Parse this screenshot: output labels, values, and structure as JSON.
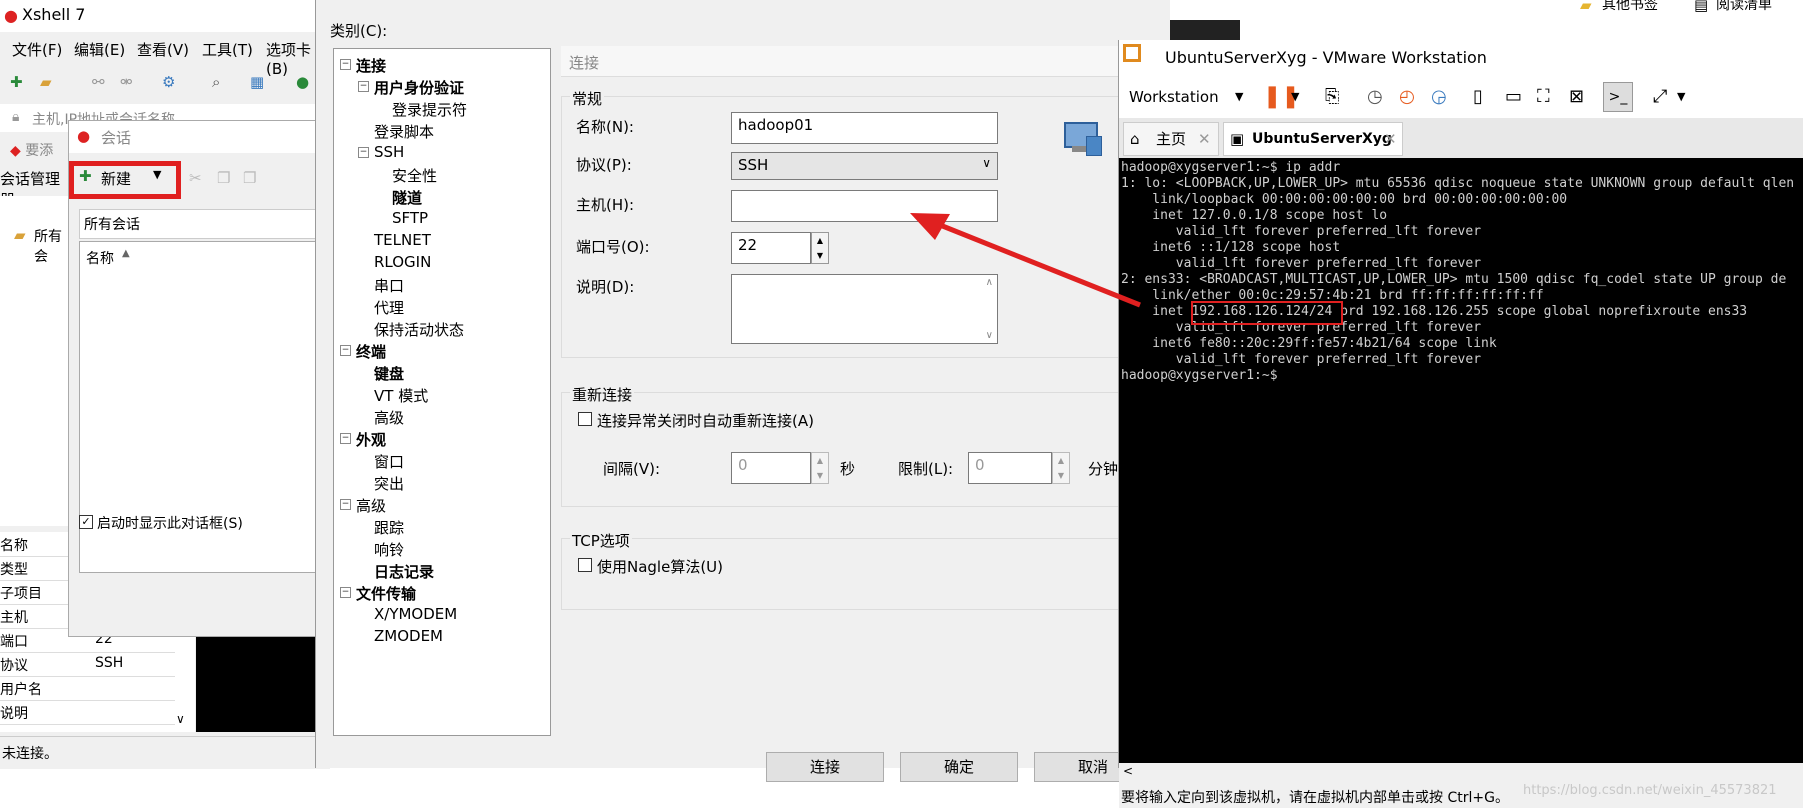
{
  "xshell": {
    "title": "Xshell 7",
    "menu": [
      "文件(F)",
      "编辑(E)",
      "查看(V)",
      "工具(T)",
      "选项卡(B)"
    ],
    "address_placeholder": "主机,IP地址或会话名称",
    "add_hint": "要添",
    "session_manager": "会话管理器",
    "tree_all": "所有会",
    "props": [
      {
        "k": "名称",
        "v": ""
      },
      {
        "k": "类型",
        "v": ""
      },
      {
        "k": "子项目",
        "v": ""
      },
      {
        "k": "主机",
        "v": ""
      },
      {
        "k": "端口",
        "v": "22"
      },
      {
        "k": "协议",
        "v": "SSH"
      },
      {
        "k": "用户名",
        "v": ""
      },
      {
        "k": "说明",
        "v": ""
      }
    ],
    "status": "未连接。"
  },
  "session_dialog": {
    "title": "会话",
    "new_label": "新建",
    "all_sessions": "所有会话",
    "col_name": "名称",
    "show_on_start": "启动时显示此对话框(S)"
  },
  "properties_dialog": {
    "category_label": "类别(C):",
    "tree": [
      {
        "label": "连接",
        "level": 0,
        "bold": true,
        "box": "−"
      },
      {
        "label": "用户身份验证",
        "level": 1,
        "bold": true,
        "box": "−"
      },
      {
        "label": "登录提示符",
        "level": 2,
        "bold": false,
        "box": ""
      },
      {
        "label": "登录脚本",
        "level": 1,
        "bold": false,
        "box": ""
      },
      {
        "label": "SSH",
        "level": 1,
        "bold": false,
        "box": "−"
      },
      {
        "label": "安全性",
        "level": 2,
        "bold": false,
        "box": ""
      },
      {
        "label": "隧道",
        "level": 2,
        "bold": true,
        "box": ""
      },
      {
        "label": "SFTP",
        "level": 2,
        "bold": false,
        "box": ""
      },
      {
        "label": "TELNET",
        "level": 1,
        "bold": false,
        "box": ""
      },
      {
        "label": "RLOGIN",
        "level": 1,
        "bold": false,
        "box": ""
      },
      {
        "label": "串口",
        "level": 1,
        "bold": false,
        "box": ""
      },
      {
        "label": "代理",
        "level": 1,
        "bold": false,
        "box": ""
      },
      {
        "label": "保持活动状态",
        "level": 1,
        "bold": false,
        "box": ""
      },
      {
        "label": "终端",
        "level": 0,
        "bold": true,
        "box": "−"
      },
      {
        "label": "键盘",
        "level": 1,
        "bold": true,
        "box": ""
      },
      {
        "label": "VT 模式",
        "level": 1,
        "bold": false,
        "box": ""
      },
      {
        "label": "高级",
        "level": 1,
        "bold": false,
        "box": ""
      },
      {
        "label": "外观",
        "level": 0,
        "bold": true,
        "box": "−"
      },
      {
        "label": "窗口",
        "level": 1,
        "bold": false,
        "box": ""
      },
      {
        "label": "突出",
        "level": 1,
        "bold": false,
        "box": ""
      },
      {
        "label": "高级",
        "level": 0,
        "bold": false,
        "box": "−"
      },
      {
        "label": "跟踪",
        "level": 1,
        "bold": false,
        "box": ""
      },
      {
        "label": "响铃",
        "level": 1,
        "bold": false,
        "box": ""
      },
      {
        "label": "日志记录",
        "level": 1,
        "bold": true,
        "box": ""
      },
      {
        "label": "文件传输",
        "level": 0,
        "bold": true,
        "box": "−"
      },
      {
        "label": "X/YMODEM",
        "level": 1,
        "bold": false,
        "box": ""
      },
      {
        "label": "ZMODEM",
        "level": 1,
        "bold": false,
        "box": ""
      }
    ],
    "section_title": "连接",
    "general": "常规",
    "name_label": "名称(N):",
    "name_value": "hadoop01",
    "protocol_label": "协议(P):",
    "protocol_value": "SSH",
    "host_label": "主机(H):",
    "host_value": "",
    "port_label": "端口号(O):",
    "port_value": "22",
    "desc_label": "说明(D):",
    "reconnect": "重新连接",
    "reconnect_check": "连接异常关闭时自动重新连接(A)",
    "interval_label": "间隔(V):",
    "interval_value": "0",
    "sec": "秒",
    "limit_label": "限制(L):",
    "limit_value": "0",
    "min": "分钟",
    "tcp": "TCP选项",
    "nagle": "使用Nagle算法(U)",
    "btn_connect": "连接",
    "btn_ok": "确定",
    "btn_cancel": "取消"
  },
  "vmware": {
    "title": "UbuntuServerXyg - VMware Workstation",
    "menu_label": "Workstation",
    "tab_home": "主页",
    "tab_vm": "UbuntuServerXyg",
    "terminal_lines": [
      "hadoop@xygserver1:~$ ip addr",
      "1: lo: <LOOPBACK,UP,LOWER_UP> mtu 65536 qdisc noqueue state UNKNOWN group default qlen",
      "    link/loopback 00:00:00:00:00:00 brd 00:00:00:00:00:00",
      "    inet 127.0.0.1/8 scope host lo",
      "       valid_lft forever preferred_lft forever",
      "    inet6 ::1/128 scope host",
      "       valid_lft forever preferred_lft forever",
      "2: ens33: <BROADCAST,MULTICAST,UP,LOWER_UP> mtu 1500 qdisc fq_codel state UP group de",
      "    link/ether 00:0c:29:57:4b:21 brd ff:ff:ff:ff:ff:ff",
      "    inet 192.168.126.124/24 brd 192.168.126.255 scope global noprefixroute ens33",
      "       valid_lft forever preferred_lft forever",
      "    inet6 fe80::20c:29ff:fe57:4b21/64 scope link",
      "       valid_lft forever preferred_lft forever",
      "hadoop@xygserver1:~$"
    ],
    "status": "要将输入定向到该虚拟机，请在虚拟机内部单击或按 Ctrl+G。",
    "watermark": "https://blog.csdn.net/weixin_45573821"
  },
  "browser": {
    "bookmark1": "其他书签",
    "bookmark2": "阅读清单"
  },
  "colors": {
    "highlight_red": "#e02020",
    "terminal_bg": "#000000"
  }
}
